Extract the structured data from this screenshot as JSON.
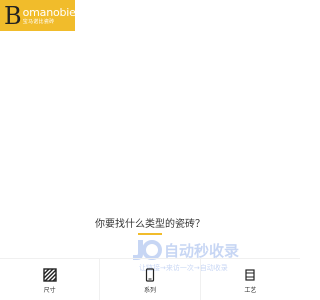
{
  "header": {
    "logo_letter": "B",
    "logo_name": "omanobie",
    "logo_subtitle": "宝马诺比瓷砖",
    "logo_bg_color": "#f1bc2b"
  },
  "main": {
    "question": "你要找什么类型的瓷砖？",
    "accent_color": "#f1bc2b"
  },
  "watermark": {
    "brand": "自动秒收录",
    "tagline": "让链接→来访一次→自动收录"
  },
  "categories": [
    {
      "label": "尺寸",
      "icon": "hatched-square-icon"
    },
    {
      "label": "系列",
      "icon": "phone-outline-icon"
    },
    {
      "label": "工艺",
      "icon": "tile-chip-icon"
    }
  ]
}
